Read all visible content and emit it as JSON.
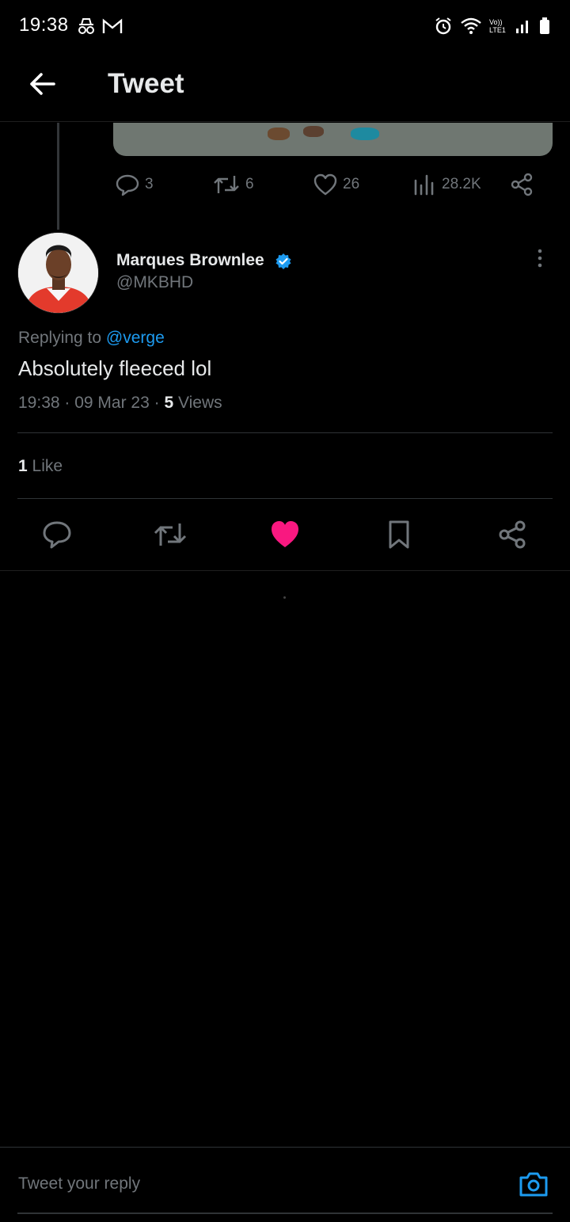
{
  "status_bar": {
    "time": "19:38",
    "left_icons": [
      "incognito-icon",
      "gmail-icon"
    ],
    "right_icons": [
      "alarm-icon",
      "wifi-icon",
      "volte-icon",
      "signal-icon",
      "battery-icon"
    ],
    "volte_label": "Vo)) LTE1"
  },
  "header": {
    "title": "Tweet"
  },
  "previous_tweet": {
    "replies": "3",
    "retweets": "6",
    "likes": "26",
    "views": "28.2K"
  },
  "tweet": {
    "author_name": "Marques Brownlee",
    "author_handle": "@MKBHD",
    "replying_prefix": "Replying to ",
    "replying_to": "@verge",
    "text": "Absolutely fleeced lol",
    "time": "19:38",
    "date": "09 Mar 23",
    "views_count": "5",
    "views_label": " Views",
    "likes_count": "1",
    "likes_label": " Like",
    "liked": true
  },
  "reply_bar": {
    "placeholder": "Tweet your reply"
  },
  "colors": {
    "background": "#000000",
    "text_primary": "#e7e9ea",
    "text_secondary": "#71767b",
    "accent": "#1d9bf0",
    "like": "#f91880"
  }
}
